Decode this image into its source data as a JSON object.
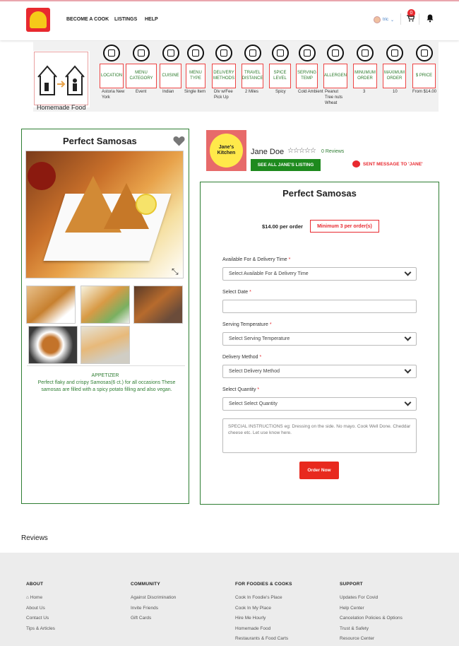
{
  "header": {
    "nav": [
      "BECOME A COOK",
      "LISTINGS",
      "HELP"
    ],
    "user_label": "tric",
    "cart_count": "0",
    "icons": {
      "logo": "toast-logo-icon",
      "cart": "cart-icon",
      "bell": "bell-icon"
    }
  },
  "attributes": {
    "brand_text": "Homemade Food",
    "items": [
      {
        "label": "LOCATION",
        "value": "Astoria New York",
        "icon": "location-icon"
      },
      {
        "label": "MENU CATEGORY",
        "value": "Event",
        "icon": "menu-list-icon"
      },
      {
        "label": "CUISINE",
        "value": "Indian",
        "icon": "cutlery-icon"
      },
      {
        "label": "MENU TYPE",
        "value": "Single Item",
        "icon": "cloche-icon"
      },
      {
        "label": "DELIVERY METHODS",
        "value": "Dlv w/Fee Pick Up",
        "icon": "delivery-scooter-icon"
      },
      {
        "label": "TRAVEL DISTANCE",
        "value": "2 Miles",
        "icon": "travel-route-icon"
      },
      {
        "label": "SPICE LEVEL",
        "value": "Spicy",
        "icon": "chili-icon"
      },
      {
        "label": "SERVING TEMP",
        "value": "Cold Ambient",
        "icon": "bowl-icon"
      },
      {
        "label": "ALLERGEN",
        "value": "Peanut Tree nuts Wheat",
        "icon": "allergen-icon"
      },
      {
        "label": "MINUMUM ORDER",
        "value": "3",
        "icon": "person-icon"
      },
      {
        "label": "MAXIMUM ORDER",
        "value": "10",
        "icon": "group-icon"
      },
      {
        "label": "$ PRICE",
        "value": "From $14.00",
        "icon": "dollar-icon"
      }
    ]
  },
  "listing": {
    "title": "Perfect Samosas",
    "category": "APPETIZER",
    "description": "Perfect flaky and crispy Samosas(6 ct.) for all occasions These samosas are filled with a spicy potato filling and also vegan."
  },
  "cook": {
    "kitchen_name": "Jane's Kitchen",
    "name": "Jane Doe",
    "stars": "☆☆☆☆☆",
    "reviews": "0 Reviews",
    "see_all": "SEE ALL JANE'S LISTING",
    "sent_message": "SENT MESSAGE TO 'JANE'"
  },
  "order": {
    "title": "Perfect Samosas",
    "price": "$14.00 per order",
    "minimum": "Minimum 3 per order(s)",
    "fields": {
      "available_label": "Available For & Delivery Time",
      "available_placeholder": "Select Available For & Delivery Time",
      "date_label": "Select Date",
      "temp_label": "Serving Temperature",
      "temp_placeholder": "Select Serving Temperature",
      "delivery_label": "Delivery Method",
      "delivery_placeholder": "Select Delivery Method",
      "quantity_label": "Select Quantity",
      "quantity_placeholder": "Select Select Quantity",
      "special_placeholder": "SPECIAL INSTRUCTIONS eg: Dressing on the side. No mayo. Cook Well Done. Cheddar cheese etc. Let use know here.",
      "required_mark": "*"
    },
    "button": "Order Now"
  },
  "reviews_heading": "Reviews",
  "footer": {
    "columns": [
      {
        "heading": "ABOUT",
        "links": [
          "Home",
          "About Us",
          "Contact Us",
          "Tips & Articles"
        ]
      },
      {
        "heading": "COMMUNITY",
        "links": [
          "Against Discrimination",
          "Invite Friends",
          "Gift Cards"
        ]
      },
      {
        "heading": "FOR FOODIES & COOKS",
        "links": [
          "Cook In Foodie's Place",
          "Cook In My Place",
          "Hire Me Hourly",
          "Homemade Food",
          "Restaurants & Food Carts"
        ]
      },
      {
        "heading": "SUPPORT",
        "links": [
          "Updates For Covid",
          "Help Center",
          "Cancelation Policies & Options",
          "Trust & Safety",
          "Resource Center"
        ]
      }
    ]
  },
  "colors": {
    "brand_red": "#e8292f",
    "brand_green": "#2e7d32",
    "accent_yellow": "#f5c919"
  }
}
